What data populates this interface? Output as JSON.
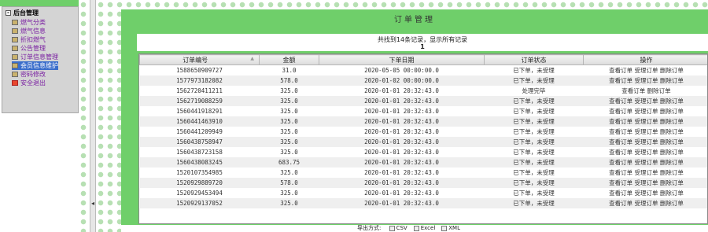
{
  "sidebar": {
    "title": "后台管理",
    "items": [
      {
        "label": "燃气分类",
        "icon": "category-icon"
      },
      {
        "label": "燃气信息",
        "icon": "info-icon"
      },
      {
        "label": "折扣燃气",
        "icon": "discount-icon"
      },
      {
        "label": "公告管理",
        "icon": "notice-icon"
      },
      {
        "label": "订单信息管理",
        "icon": "order-icon"
      },
      {
        "label": "会员信息维护",
        "icon": "member-icon"
      },
      {
        "label": "密码修改",
        "icon": "password-icon"
      },
      {
        "label": "安全退出",
        "icon": "exit-icon"
      }
    ],
    "selected_index": 5
  },
  "main": {
    "title": "订单管理",
    "records_text": "共找到14条记录，显示所有记录",
    "page_number": "1"
  },
  "table": {
    "headers": [
      "订单编号",
      "金额",
      "下单日期",
      "订单状态",
      "操作"
    ],
    "rows": [
      [
        "1588650909727",
        "31.0",
        "2020-05-05 00:00:00.0",
        "已下单，未受理",
        "查看订单 受理订单 删除订单"
      ],
      [
        "1577973182082",
        "578.0",
        "2020-01-02 00:00:00.0",
        "已下单，未受理",
        "查看订单 受理订单 删除订单"
      ],
      [
        "1562720411211",
        "325.0",
        "2020-01-01 20:32:43.0",
        "处理完毕",
        "查看订单 删除订单"
      ],
      [
        "1562719088259",
        "325.0",
        "2020-01-01 20:32:43.0",
        "已下单，未受理",
        "查看订单 受理订单 删除订单"
      ],
      [
        "1560441918291",
        "325.0",
        "2020-01-01 20:32:43.0",
        "已下单，未受理",
        "查看订单 受理订单 删除订单"
      ],
      [
        "1560441463910",
        "325.0",
        "2020-01-01 20:32:43.0",
        "已下单，未受理",
        "查看订单 受理订单 删除订单"
      ],
      [
        "1560441209949",
        "325.0",
        "2020-01-01 20:32:43.0",
        "已下单，未受理",
        "查看订单 受理订单 删除订单"
      ],
      [
        "1560438758947",
        "325.0",
        "2020-01-01 20:32:43.0",
        "已下单，未受理",
        "查看订单 受理订单 删除订单"
      ],
      [
        "1560438723158",
        "325.0",
        "2020-01-01 20:32:43.0",
        "已下单，未受理",
        "查看订单 受理订单 删除订单"
      ],
      [
        "1560438083245",
        "683.75",
        "2020-01-01 20:32:43.0",
        "已下单，未受理",
        "查看订单 受理订单 删除订单"
      ],
      [
        "1520107354985",
        "325.0",
        "2020-01-01 20:32:43.0",
        "已下单，未受理",
        "查看订单 受理订单 删除订单"
      ],
      [
        "1520929889720",
        "578.0",
        "2020-01-01 20:32:43.0",
        "已下单，未受理",
        "查看订单 受理订单 删除订单"
      ],
      [
        "1520929453494",
        "325.0",
        "2020-01-01 20:32:43.0",
        "已下单，未受理",
        "查看订单 受理订单 删除订单"
      ],
      [
        "1520929137052",
        "325.0",
        "2020-01-01 20:32:43.0",
        "已下单，未受理",
        "查看订单 受理订单 删除订单"
      ]
    ]
  },
  "export": {
    "label": "导出方式:",
    "options": [
      {
        "label": "CSV",
        "icon": "csv-icon"
      },
      {
        "label": "Excel",
        "icon": "excel-icon"
      },
      {
        "label": "XML",
        "icon": "xml-icon"
      }
    ]
  },
  "colors": {
    "panel": "#6fcf6a",
    "selected": "#3b6ecb",
    "menu_text": "#7a1fa2"
  }
}
